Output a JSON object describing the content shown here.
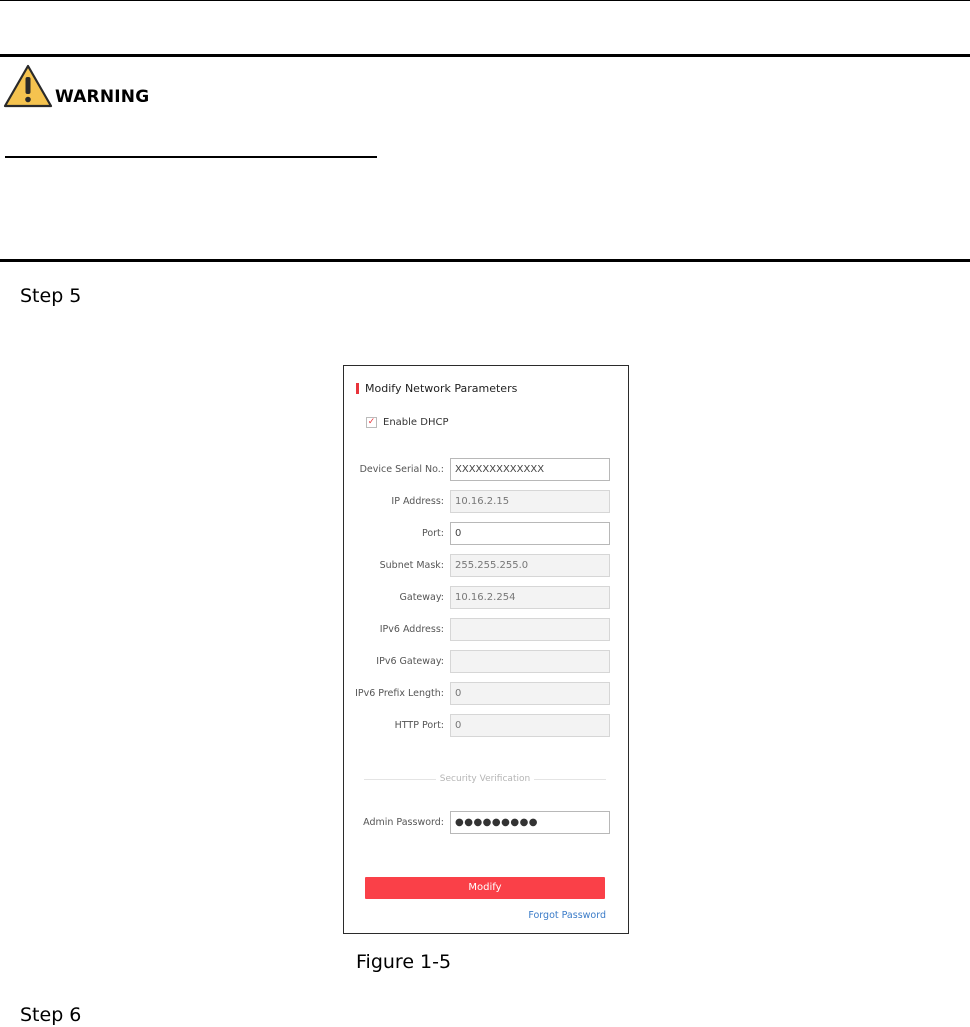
{
  "warning": {
    "label": "WARNING"
  },
  "steps": {
    "step5": "Step 5",
    "step6": "Step 6"
  },
  "figure": {
    "caption": "Figure 1-5"
  },
  "dialog": {
    "title": "Modify Network Parameters",
    "dhcp": {
      "label": "Enable DHCP",
      "checked": true,
      "check_glyph": "✓"
    },
    "fields": [
      {
        "label": "Device Serial No.:",
        "value": "XXXXXXXXXXXXX"
      },
      {
        "label": "IP Address:",
        "value": "10.16.2.15"
      },
      {
        "label": "Port:",
        "value": "0"
      },
      {
        "label": "Subnet Mask:",
        "value": "255.255.255.0"
      },
      {
        "label": "Gateway:",
        "value": "10.16.2.254"
      },
      {
        "label": "IPv6 Address:",
        "value": ""
      },
      {
        "label": "IPv6 Gateway:",
        "value": ""
      },
      {
        "label": "IPv6 Prefix Length:",
        "value": "0"
      },
      {
        "label": "HTTP Port:",
        "value": "0"
      }
    ],
    "security_label": "Security Verification",
    "admin_password": {
      "label": "Admin Password:",
      "value": "●●●●●●●●●"
    },
    "modify_label": "Modify",
    "forgot_label": "Forgot Password"
  },
  "colors": {
    "accent": "#fa4048",
    "link": "#3a7bc8",
    "warning_fill": "#f5c34f"
  }
}
